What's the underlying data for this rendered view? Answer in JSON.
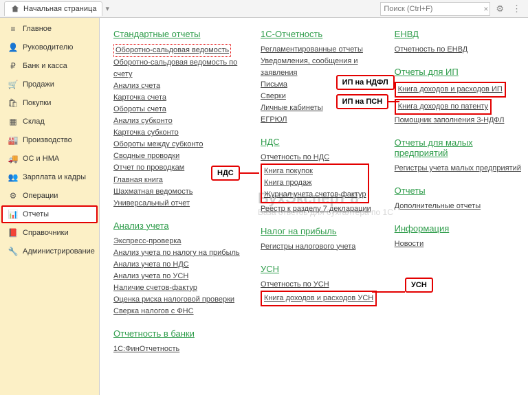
{
  "topbar": {
    "home_tab": "Начальная страница",
    "search_placeholder": "Поиск (Ctrl+F)"
  },
  "sidebar": [
    {
      "icon": "≡",
      "label": "Главное"
    },
    {
      "icon": "👤",
      "label": "Руководителю"
    },
    {
      "icon": "₽",
      "label": "Банк и касса"
    },
    {
      "icon": "🛒",
      "label": "Продажи"
    },
    {
      "icon": "🛍",
      "label": "Покупки"
    },
    {
      "icon": "▦",
      "label": "Склад"
    },
    {
      "icon": "🏭",
      "label": "Производство"
    },
    {
      "icon": "🚚",
      "label": "ОС и НМА"
    },
    {
      "icon": "👥",
      "label": "Зарплата и кадры"
    },
    {
      "icon": "⚙",
      "label": "Операции"
    },
    {
      "icon": "📊",
      "label": "Отчеты"
    },
    {
      "icon": "📕",
      "label": "Справочники"
    },
    {
      "icon": "🔧",
      "label": "Администрирование"
    }
  ],
  "callouts": {
    "nds": "НДС",
    "ip_ndfl": "ИП на НДФЛ",
    "ip_psn": "ИП на ПСН",
    "usn": "УСН"
  },
  "col1": {
    "std_title": "Стандартные отчеты",
    "std": [
      "Оборотно-сальдовая ведомость",
      "Оборотно-сальдовая ведомость по счету",
      "Анализ счета",
      "Карточка счета",
      "Обороты счета",
      "Анализ субконто",
      "Карточка субконто",
      "Обороты между субконто",
      "Сводные проводки",
      "Отчет по проводкам",
      "Главная книга",
      "Шахматная ведомость",
      "Универсальный отчет"
    ],
    "analiz_title": "Анализ учета",
    "analiz": [
      "Экспресс-проверка",
      "Анализ учета по налогу на прибыль",
      "Анализ учета по НДС",
      "Анализ учета по УСН",
      "Наличие счетов-фактур",
      "Оценка риска налоговой проверки",
      "Сверка налогов с ФНС"
    ],
    "bank_title": "Отчетность в банки",
    "bank": [
      "1С:ФинОтчетность"
    ]
  },
  "col2": {
    "c1_title": "1С-Отчетность",
    "c1": [
      "Регламентированные отчеты",
      "Уведомления, сообщения и заявления",
      "Письма",
      "Сверки",
      "Личные кабинеты",
      "ЕГРЮЛ"
    ],
    "nds_title": "НДС",
    "nds_top": [
      "Отчетность по НДС"
    ],
    "nds_box": [
      "Книга покупок",
      "Книга продаж",
      "Журнал учета счетов-фактур"
    ],
    "nds_bottom": [
      "Реестр к разделу 7 декларации"
    ],
    "np_title": "Налог на прибыль",
    "np": [
      "Регистры налогового учета"
    ],
    "usn_title": "УСН",
    "usn_top": [
      "Отчетность по УСН"
    ],
    "usn_box": [
      "Книга доходов и расходов УСН"
    ]
  },
  "col3": {
    "envd_title": "ЕНВД",
    "envd": [
      "Отчетность по ЕНВД"
    ],
    "ip_title": "Отчеты для ИП",
    "ip": [
      "Книга доходов и расходов ИП",
      "Книга доходов по патенту",
      "Помощник заполнения 3-НДФЛ"
    ],
    "mp_title": "Отчеты для малых предприятий",
    "mp": [
      "Регистры учета малых предприятий"
    ],
    "ot_title": "Отчеты",
    "ot": [
      "Дополнительные отчеты"
    ],
    "info_title": "Информация",
    "info": [
      "Новости"
    ]
  },
  "watermark": {
    "big": "БухЭксперт 8",
    "small": "База ответов для бухгалтера по 1С"
  }
}
